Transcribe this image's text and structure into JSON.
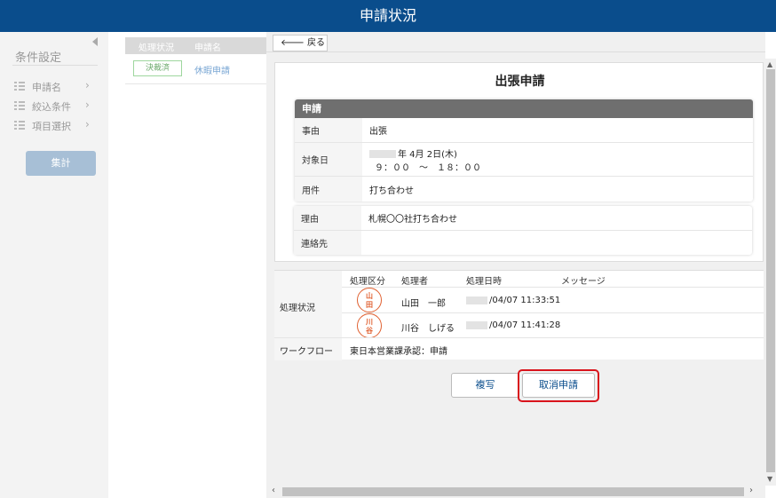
{
  "window": {
    "title": "申請状況"
  },
  "sidebar": {
    "heading": "条件設定",
    "items": [
      {
        "label": "申請名"
      },
      {
        "label": "絞込条件"
      },
      {
        "label": "項目選択"
      }
    ],
    "aggregate_button": "集計"
  },
  "results": {
    "columns": [
      "処理状況",
      "申請名"
    ],
    "rows": [
      {
        "status": "決裁済",
        "name": "休暇申請"
      }
    ]
  },
  "detail": {
    "back_label": "戻る",
    "title": "出張申請",
    "section_title": "申請",
    "fields": [
      {
        "key": "事由",
        "value": "出張"
      },
      {
        "key": "対象日",
        "date": "年 4月 2日(木)",
        "time": "９：００　～　１８：００"
      },
      {
        "key": "用件",
        "value": "打ち合わせ"
      }
    ],
    "fields2": [
      {
        "key": "理由",
        "value": "札幌〇〇社打ち合わせ"
      },
      {
        "key": "連絡先",
        "value": ""
      }
    ],
    "processing": {
      "label": "処理状況",
      "columns": [
        "処理区分",
        "処理者",
        "処理日時",
        "メッセージ"
      ],
      "rows": [
        {
          "stamp": "山田",
          "name": "山田　一郎",
          "datetime": "/04/07 11:33:51",
          "message": ""
        },
        {
          "stamp": "川谷",
          "name": "川谷　しげる",
          "datetime": "/04/07 11:41:28",
          "message": ""
        }
      ]
    },
    "workflow": {
      "label": "ワークフロー",
      "value": "東日本営業課承認：申請"
    },
    "buttons": {
      "copy": "複写",
      "cancel": "取消申請"
    }
  },
  "colors": {
    "title_bar": "#0a4d8c",
    "highlight": "#d9141c",
    "stamp": "#e06030"
  }
}
